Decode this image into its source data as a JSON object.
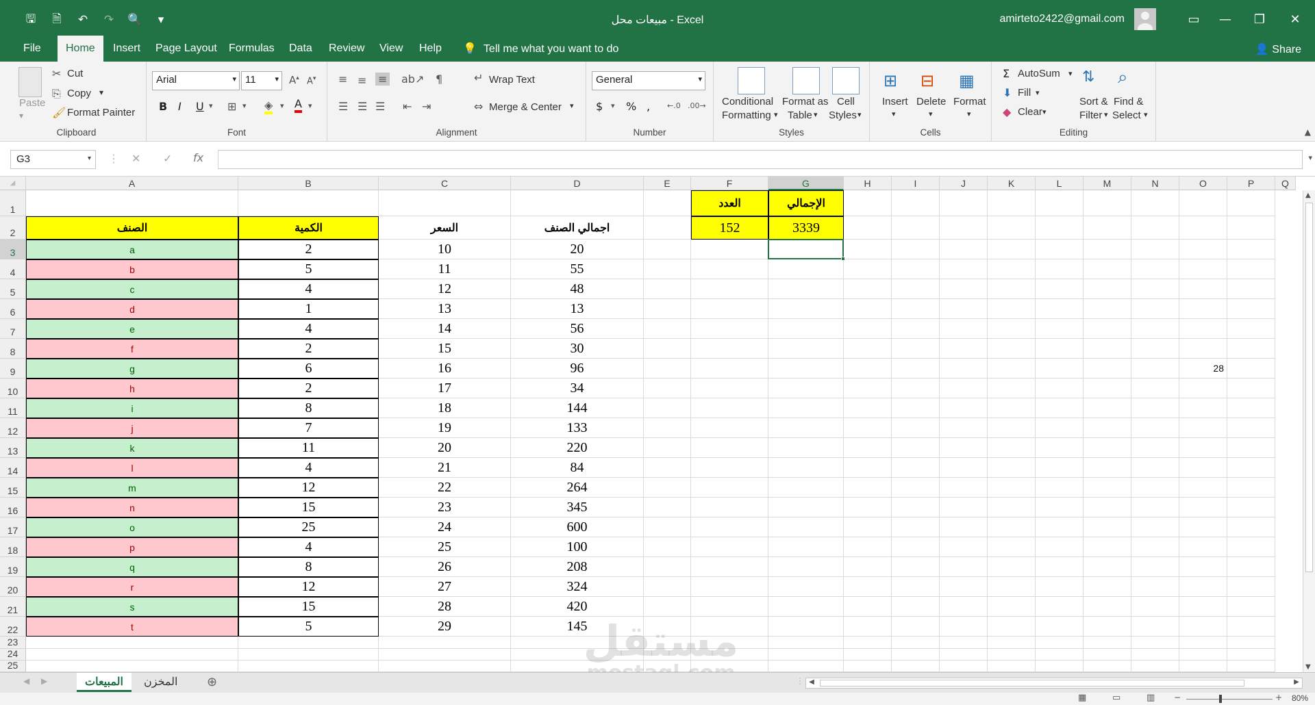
{
  "titlebar": {
    "title": "مبيعات محل  -  Excel",
    "user": "amirteto2422@gmail.com"
  },
  "menu": {
    "tabs": [
      "File",
      "Home",
      "Insert",
      "Page Layout",
      "Formulas",
      "Data",
      "Review",
      "View",
      "Help"
    ],
    "tell": "Tell me what you want to do",
    "share": "Share"
  },
  "ribbon": {
    "clipboard": {
      "paste": "Paste",
      "cut": "Cut",
      "copy": "Copy",
      "format_painter": "Format Painter",
      "label": "Clipboard"
    },
    "font": {
      "name": "Arial",
      "size": "11",
      "label": "Font"
    },
    "alignment": {
      "wrap": "Wrap Text",
      "merge": "Merge & Center",
      "label": "Alignment"
    },
    "number": {
      "format": "General",
      "label": "Number"
    },
    "styles": {
      "conditional": "Conditional",
      "conditional2": "Formatting",
      "format_as": "Format as",
      "format_as2": "Table",
      "cell": "Cell",
      "cell2": "Styles",
      "label": "Styles"
    },
    "cells": {
      "insert": "Insert",
      "delete": "Delete",
      "format": "Format",
      "label": "Cells"
    },
    "editing": {
      "autosum": "AutoSum",
      "fill": "Fill",
      "clear": "Clear",
      "sort": "Sort &",
      "sort2": "Filter",
      "find": "Find &",
      "find2": "Select",
      "label": "Editing"
    }
  },
  "formula_bar": {
    "name_box": "G3",
    "formula": ""
  },
  "columns": [
    "A",
    "B",
    "C",
    "D",
    "E",
    "F",
    "G",
    "H",
    "I",
    "J",
    "K",
    "L",
    "M",
    "N",
    "O",
    "P",
    "Q"
  ],
  "summary": {
    "count_label": "العدد",
    "total_label": "الإجمالي",
    "count_value": "152",
    "total_value": "3339"
  },
  "headers": {
    "item": "الصنف",
    "qty": "الكمية",
    "price": "السعر",
    "total": "اجمالي الصنف"
  },
  "rows": [
    {
      "item": "a",
      "qty": "2",
      "price": "10",
      "total": "20"
    },
    {
      "item": "b",
      "qty": "5",
      "price": "11",
      "total": "55"
    },
    {
      "item": "c",
      "qty": "4",
      "price": "12",
      "total": "48"
    },
    {
      "item": "d",
      "qty": "1",
      "price": "13",
      "total": "13"
    },
    {
      "item": "e",
      "qty": "4",
      "price": "14",
      "total": "56"
    },
    {
      "item": "f",
      "qty": "2",
      "price": "15",
      "total": "30"
    },
    {
      "item": "g",
      "qty": "6",
      "price": "16",
      "total": "96"
    },
    {
      "item": "h",
      "qty": "2",
      "price": "17",
      "total": "34"
    },
    {
      "item": "i",
      "qty": "8",
      "price": "18",
      "total": "144"
    },
    {
      "item": "j",
      "qty": "7",
      "price": "19",
      "total": "133"
    },
    {
      "item": "k",
      "qty": "11",
      "price": "20",
      "total": "220"
    },
    {
      "item": "l",
      "qty": "4",
      "price": "21",
      "total": "84"
    },
    {
      "item": "m",
      "qty": "12",
      "price": "22",
      "total": "264"
    },
    {
      "item": "n",
      "qty": "15",
      "price": "23",
      "total": "345"
    },
    {
      "item": "o",
      "qty": "25",
      "price": "24",
      "total": "600"
    },
    {
      "item": "p",
      "qty": "4",
      "price": "25",
      "total": "100"
    },
    {
      "item": "q",
      "qty": "8",
      "price": "26",
      "total": "208"
    },
    {
      "item": "r",
      "qty": "12",
      "price": "27",
      "total": "324"
    },
    {
      "item": "s",
      "qty": "15",
      "price": "28",
      "total": "420"
    },
    {
      "item": "t",
      "qty": "5",
      "price": "29",
      "total": "145"
    }
  ],
  "stray_cell": {
    "ref": "O9",
    "value": "28"
  },
  "sheets": {
    "active": "المبيعات",
    "other": "المخزن"
  },
  "colors": {
    "green_row": "#c6efce",
    "red_row": "#ffc7ce",
    "yellow": "#ffff00",
    "excel_green": "#217346"
  },
  "watermark": {
    "arabic": "مستقل",
    "latin": "mostaql.com"
  },
  "status": {
    "zoom": "80%"
  }
}
